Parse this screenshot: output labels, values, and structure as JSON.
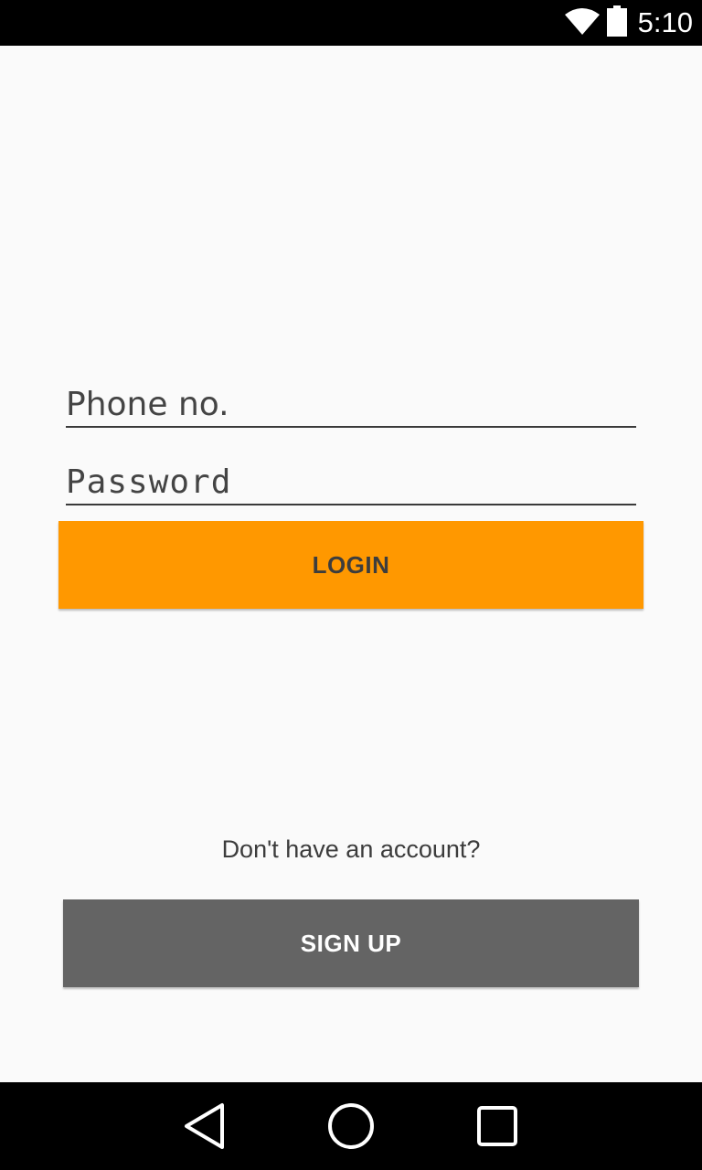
{
  "status_bar": {
    "time": "5:10",
    "icons": [
      "wifi-icon",
      "battery-icon"
    ]
  },
  "form": {
    "phone_placeholder": "Phone no.",
    "password_placeholder": "Password",
    "login_label": "LOGIN"
  },
  "signup": {
    "prompt": "Don't have an account?",
    "button_label": "SIGN UP"
  },
  "nav_bar": {
    "icons": [
      "back-icon",
      "home-icon",
      "recents-icon"
    ]
  },
  "colors": {
    "login_button": "#ff9800",
    "signup_button": "#646464",
    "background": "#fafafa"
  }
}
